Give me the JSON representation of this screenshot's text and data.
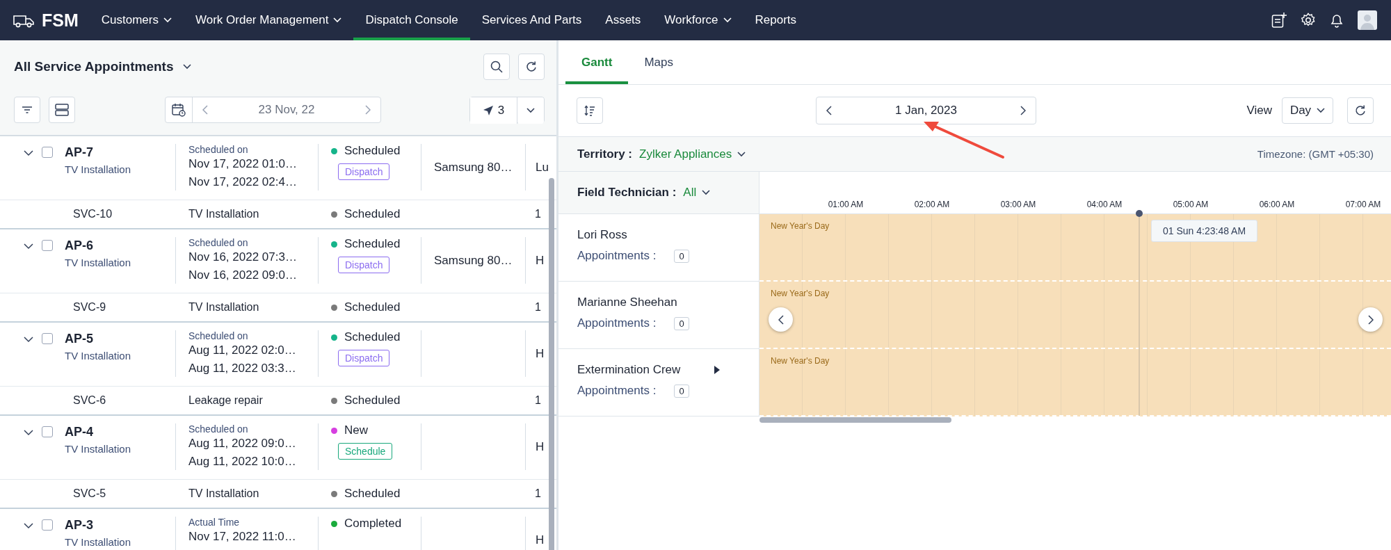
{
  "nav": {
    "logo": "FSM",
    "items": [
      {
        "label": "Customers",
        "dropdown": true,
        "selected": false
      },
      {
        "label": "Work Order Management",
        "dropdown": true,
        "selected": false
      },
      {
        "label": "Dispatch Console",
        "dropdown": false,
        "selected": true
      },
      {
        "label": "Services And Parts",
        "dropdown": false,
        "selected": false
      },
      {
        "label": "Assets",
        "dropdown": false,
        "selected": false
      },
      {
        "label": "Workforce",
        "dropdown": true,
        "selected": false
      },
      {
        "label": "Reports",
        "dropdown": false,
        "selected": false
      }
    ]
  },
  "appointments_panel": {
    "title": "All Service Appointments",
    "date": "23 Nov, 22",
    "dispatch_count": "3",
    "appointments": [
      {
        "id": "AP-7",
        "type": "TV Installation",
        "expanded": true,
        "checked": false,
        "time_label": "Scheduled on",
        "times": [
          "Nov 17, 2022 01:0…",
          "Nov 17, 2022 02:4…"
        ],
        "status": "Scheduled",
        "color": "#15b48a",
        "action": {
          "kind": "dispatch",
          "label": "Dispatch"
        },
        "product": "Samsung 80…",
        "column_5": "Lu",
        "service": {
          "id": "SVC-10",
          "name": "TV Installation",
          "status": "Scheduled",
          "color": "#7a7a7a",
          "column_5": "1"
        }
      },
      {
        "id": "AP-6",
        "type": "TV Installation",
        "expanded": true,
        "checked": false,
        "time_label": "Scheduled on",
        "times": [
          "Nov 16, 2022 07:3…",
          "Nov 16, 2022 09:0…"
        ],
        "status": "Scheduled",
        "color": "#15b48a",
        "action": {
          "kind": "dispatch",
          "label": "Dispatch"
        },
        "product": "Samsung 80…",
        "column_5": "H",
        "service": {
          "id": "SVC-9",
          "name": "TV Installation",
          "status": "Scheduled",
          "color": "#7a7a7a",
          "column_5": "1"
        }
      },
      {
        "id": "AP-5",
        "type": "TV Installation",
        "expanded": true,
        "checked": false,
        "time_label": "Scheduled on",
        "times": [
          "Aug 11, 2022 02:0…",
          "Aug 11, 2022 03:3…"
        ],
        "status": "Scheduled",
        "color": "#15b48a",
        "action": {
          "kind": "dispatch",
          "label": "Dispatch"
        },
        "column_5": "H",
        "service": {
          "id": "SVC-6",
          "name": "Leakage repair",
          "status": "Scheduled",
          "color": "#7a7a7a",
          "column_5": "1"
        }
      },
      {
        "id": "AP-4",
        "type": "TV Installation",
        "expanded": true,
        "checked": false,
        "time_label": "Scheduled on",
        "times": [
          "Aug 11, 2022 09:0…",
          "Aug 11, 2022 10:0…"
        ],
        "status": "New",
        "color": "#d63fe0",
        "action": {
          "kind": "schedule",
          "label": "Schedule"
        },
        "column_5": "H",
        "service": {
          "id": "SVC-5",
          "name": "TV Installation",
          "status": "Scheduled",
          "color": "#7a7a7a",
          "column_5": "1"
        }
      },
      {
        "id": "AP-3",
        "type": "TV Installation",
        "expanded": true,
        "checked": false,
        "time_label": "Actual Time",
        "times": [
          "Nov 17, 2022 11:0…"
        ],
        "status": "Completed",
        "color": "#1aab3c",
        "column_5": "H"
      }
    ]
  },
  "gantt_panel": {
    "tabs": [
      {
        "label": "Gantt",
        "selected": true
      },
      {
        "label": "Maps",
        "selected": false
      }
    ],
    "date": "1 Jan, 2023",
    "view_label": "View",
    "view": "Day",
    "territory_label": "Territory :",
    "territory": "Zylker Appliances",
    "timezone": "Timezone: (GMT +05:30)",
    "technician_label": "Field Technician :",
    "technician_filter": "All",
    "hours": [
      "01:00 AM",
      "02:00 AM",
      "03:00 AM",
      "04:00 AM",
      "05:00 AM",
      "06:00 AM",
      "07:00 AM"
    ],
    "now_tooltip": "01 Sun 4:23:48 AM",
    "technicians": [
      {
        "name": "Lori Ross",
        "appointments_label": "Appointments :",
        "appointments": "0",
        "expandable": false,
        "holiday": "New Year's Day"
      },
      {
        "name": "Marianne Sheehan",
        "appointments_label": "Appointments :",
        "appointments": "0",
        "expandable": false,
        "holiday": "New Year's Day"
      },
      {
        "name": "Extermination Crew",
        "appointments_label": "Appointments :",
        "appointments": "0",
        "expandable": true,
        "holiday": "New Year's Day"
      }
    ]
  }
}
